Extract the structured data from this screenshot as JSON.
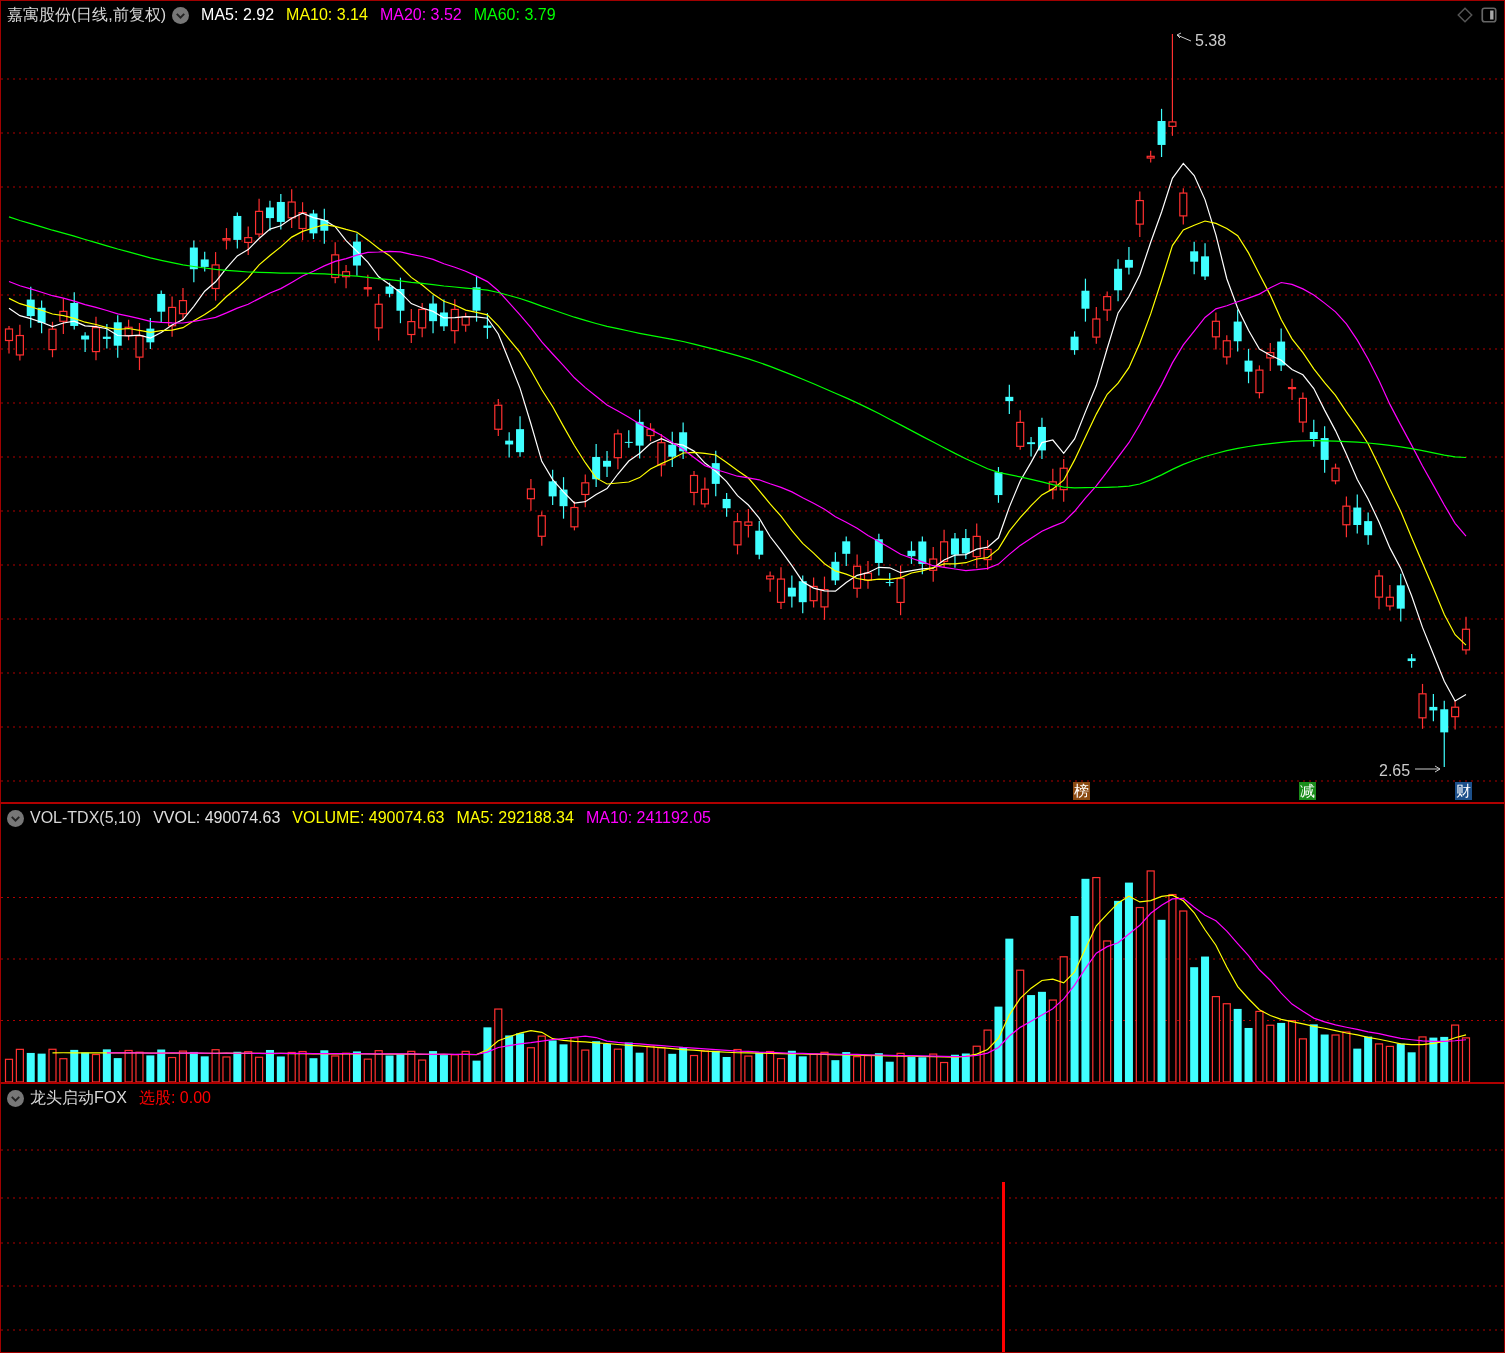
{
  "main_panel": {
    "title": "嘉寓股份(日线,前复权)",
    "legend": [
      {
        "label": "MA5: 2.92",
        "color": "#ffffff"
      },
      {
        "label": "MA10: 3.14",
        "color": "#ffff00"
      },
      {
        "label": "MA20: 3.52",
        "color": "#ff00ff"
      },
      {
        "label": "MA60: 3.79",
        "color": "#00ff00"
      }
    ],
    "high_label": "5.38",
    "low_label": "2.65",
    "markers": [
      {
        "label": "榜",
        "color": "#8b4a12"
      },
      {
        "label": "减",
        "color": "#1a8c1a"
      },
      {
        "label": "财",
        "color": "#1c4f8a"
      }
    ]
  },
  "volume_panel": {
    "title": "VOL-TDX(5,10)",
    "legend": [
      {
        "label": "VVOL: 490074.63",
        "color": "#e0e0e0"
      },
      {
        "label": "VOLUME: 490074.63",
        "color": "#ffff00"
      },
      {
        "label": "MA5: 292188.34",
        "color": "#ffff00"
      },
      {
        "label": "MA10: 241192.05",
        "color": "#ff00ff"
      }
    ]
  },
  "indicator_panel": {
    "title": "龙头启动FOX",
    "legend": [
      {
        "label": "选股: 0.00",
        "color": "#ff0000"
      }
    ]
  }
}
